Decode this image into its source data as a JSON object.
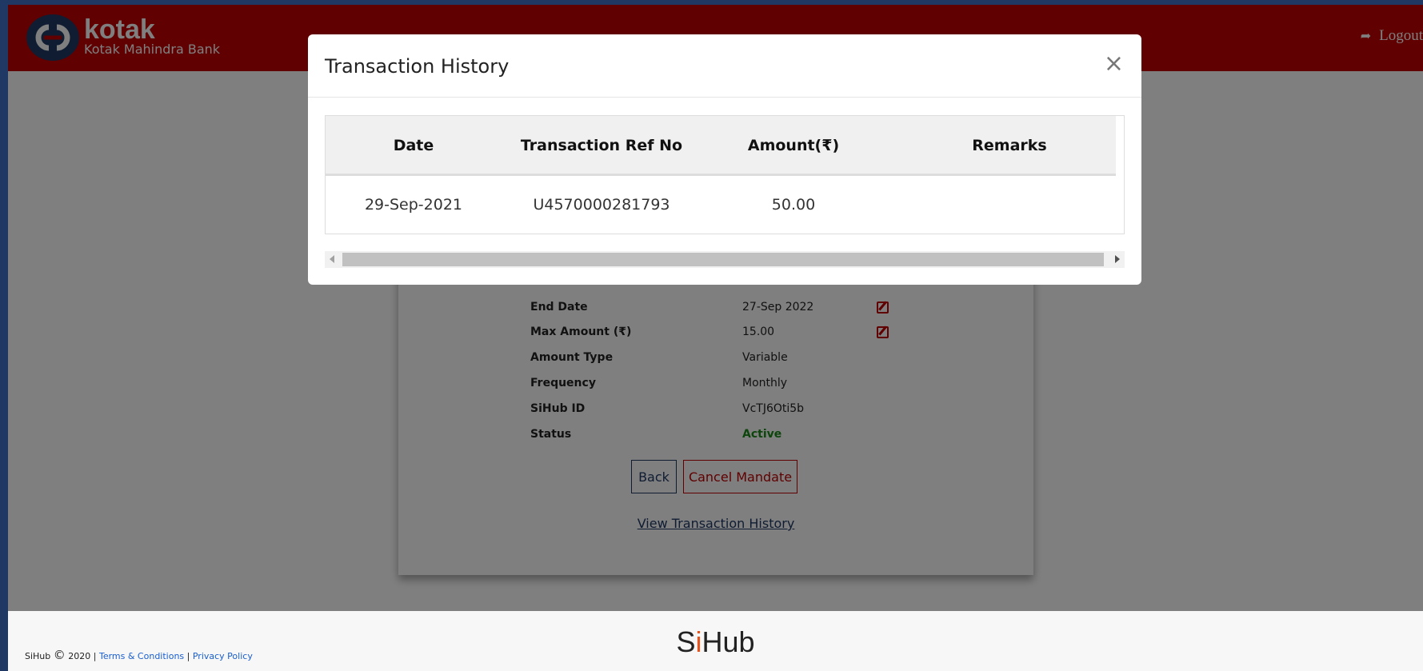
{
  "header": {
    "logo_brand": "kotak",
    "logo_sub": "Kotak Mahindra Bank",
    "logout_label": "Logout"
  },
  "mandate_details": [
    {
      "label": "End Date",
      "value": "27-Sep 2022",
      "editable": true
    },
    {
      "label": "Max Amount (₹)",
      "value": "15.00",
      "editable": true
    },
    {
      "label": "Amount Type",
      "value": "Variable",
      "editable": false
    },
    {
      "label": "Frequency",
      "value": "Monthly",
      "editable": false
    },
    {
      "label": "SiHub ID",
      "value": "VcTJ6Oti5b",
      "editable": false
    },
    {
      "label": "Status",
      "value": "Active",
      "editable": false
    }
  ],
  "actions": {
    "back_label": "Back",
    "cancel_label": "Cancel Mandate",
    "view_history_label": "View Transaction History"
  },
  "modal": {
    "title": "Transaction History",
    "close_glyph": "×",
    "columns": [
      "Date",
      "Transaction Ref No",
      "Amount(₹)",
      "Remarks"
    ],
    "rows": [
      [
        "29-Sep-2021",
        "U4570000281793",
        "50.00",
        ""
      ]
    ]
  },
  "footer": {
    "copyright_text": "SiHub",
    "copyright_year": "2020",
    "terms_label": "Terms & Conditions",
    "privacy_label": "Privacy Policy",
    "brand_s": "S",
    "brand_i": "i",
    "brand_hub": "Hub"
  },
  "colors": {
    "brand_red": "#c00000",
    "brand_navy": "#1f3864",
    "status_active": "#1a8a1a",
    "link_blue": "#1a5fd0"
  }
}
